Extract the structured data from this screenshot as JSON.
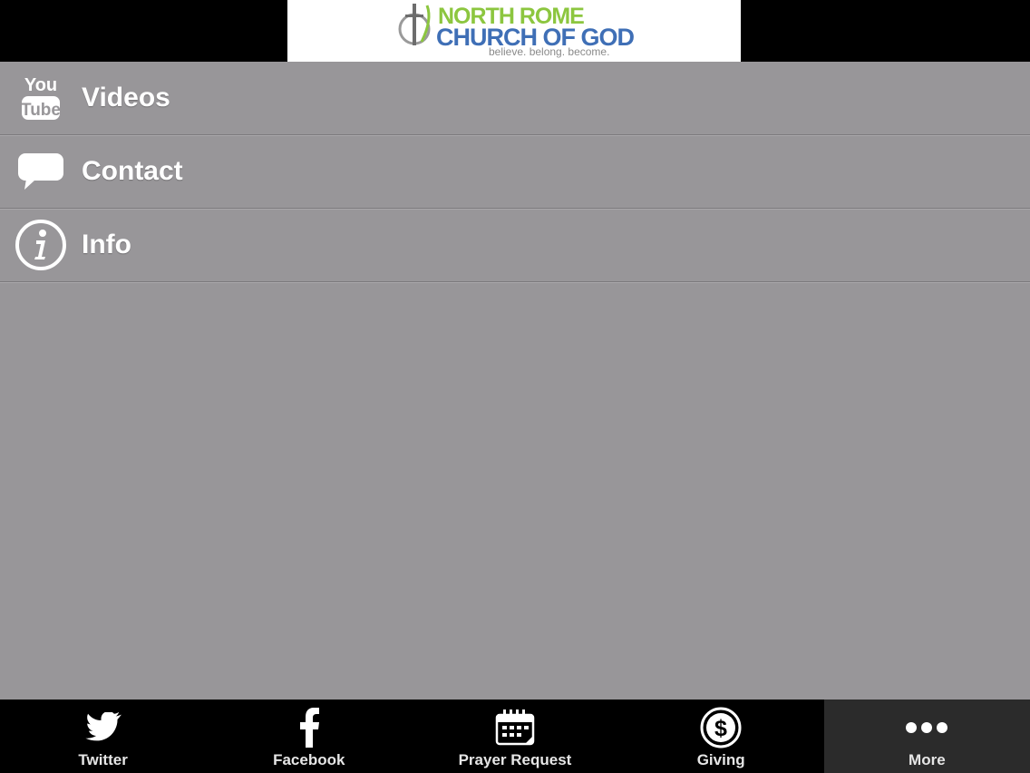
{
  "header": {
    "logo": {
      "line1": "NORTH ROME",
      "line2": "CHURCH OF GOD",
      "tagline": "believe. belong. become.",
      "colors": {
        "line1": "#8cc63f",
        "line2": "#3f6fb6"
      }
    }
  },
  "menu": {
    "items": [
      {
        "label": "Videos",
        "icon": "youtube-icon",
        "icon_text_top": "You",
        "icon_text_bottom": "Tube"
      },
      {
        "label": "Contact",
        "icon": "speech-bubble-icon"
      },
      {
        "label": "Info",
        "icon": "info-icon"
      }
    ]
  },
  "tabbar": {
    "tabs": [
      {
        "label": "Twitter",
        "icon": "twitter-bird-icon"
      },
      {
        "label": "Facebook",
        "icon": "facebook-icon"
      },
      {
        "label": "Prayer Request",
        "icon": "calendar-icon"
      },
      {
        "label": "Giving",
        "icon": "dollar-coin-icon"
      },
      {
        "label": "More",
        "icon": "more-dots-icon",
        "active": true
      }
    ]
  },
  "colors": {
    "background": "#989699",
    "header": "#000000",
    "tabbar": "#000000",
    "tab_active": "#2b2b2b",
    "text": "#ffffff"
  }
}
